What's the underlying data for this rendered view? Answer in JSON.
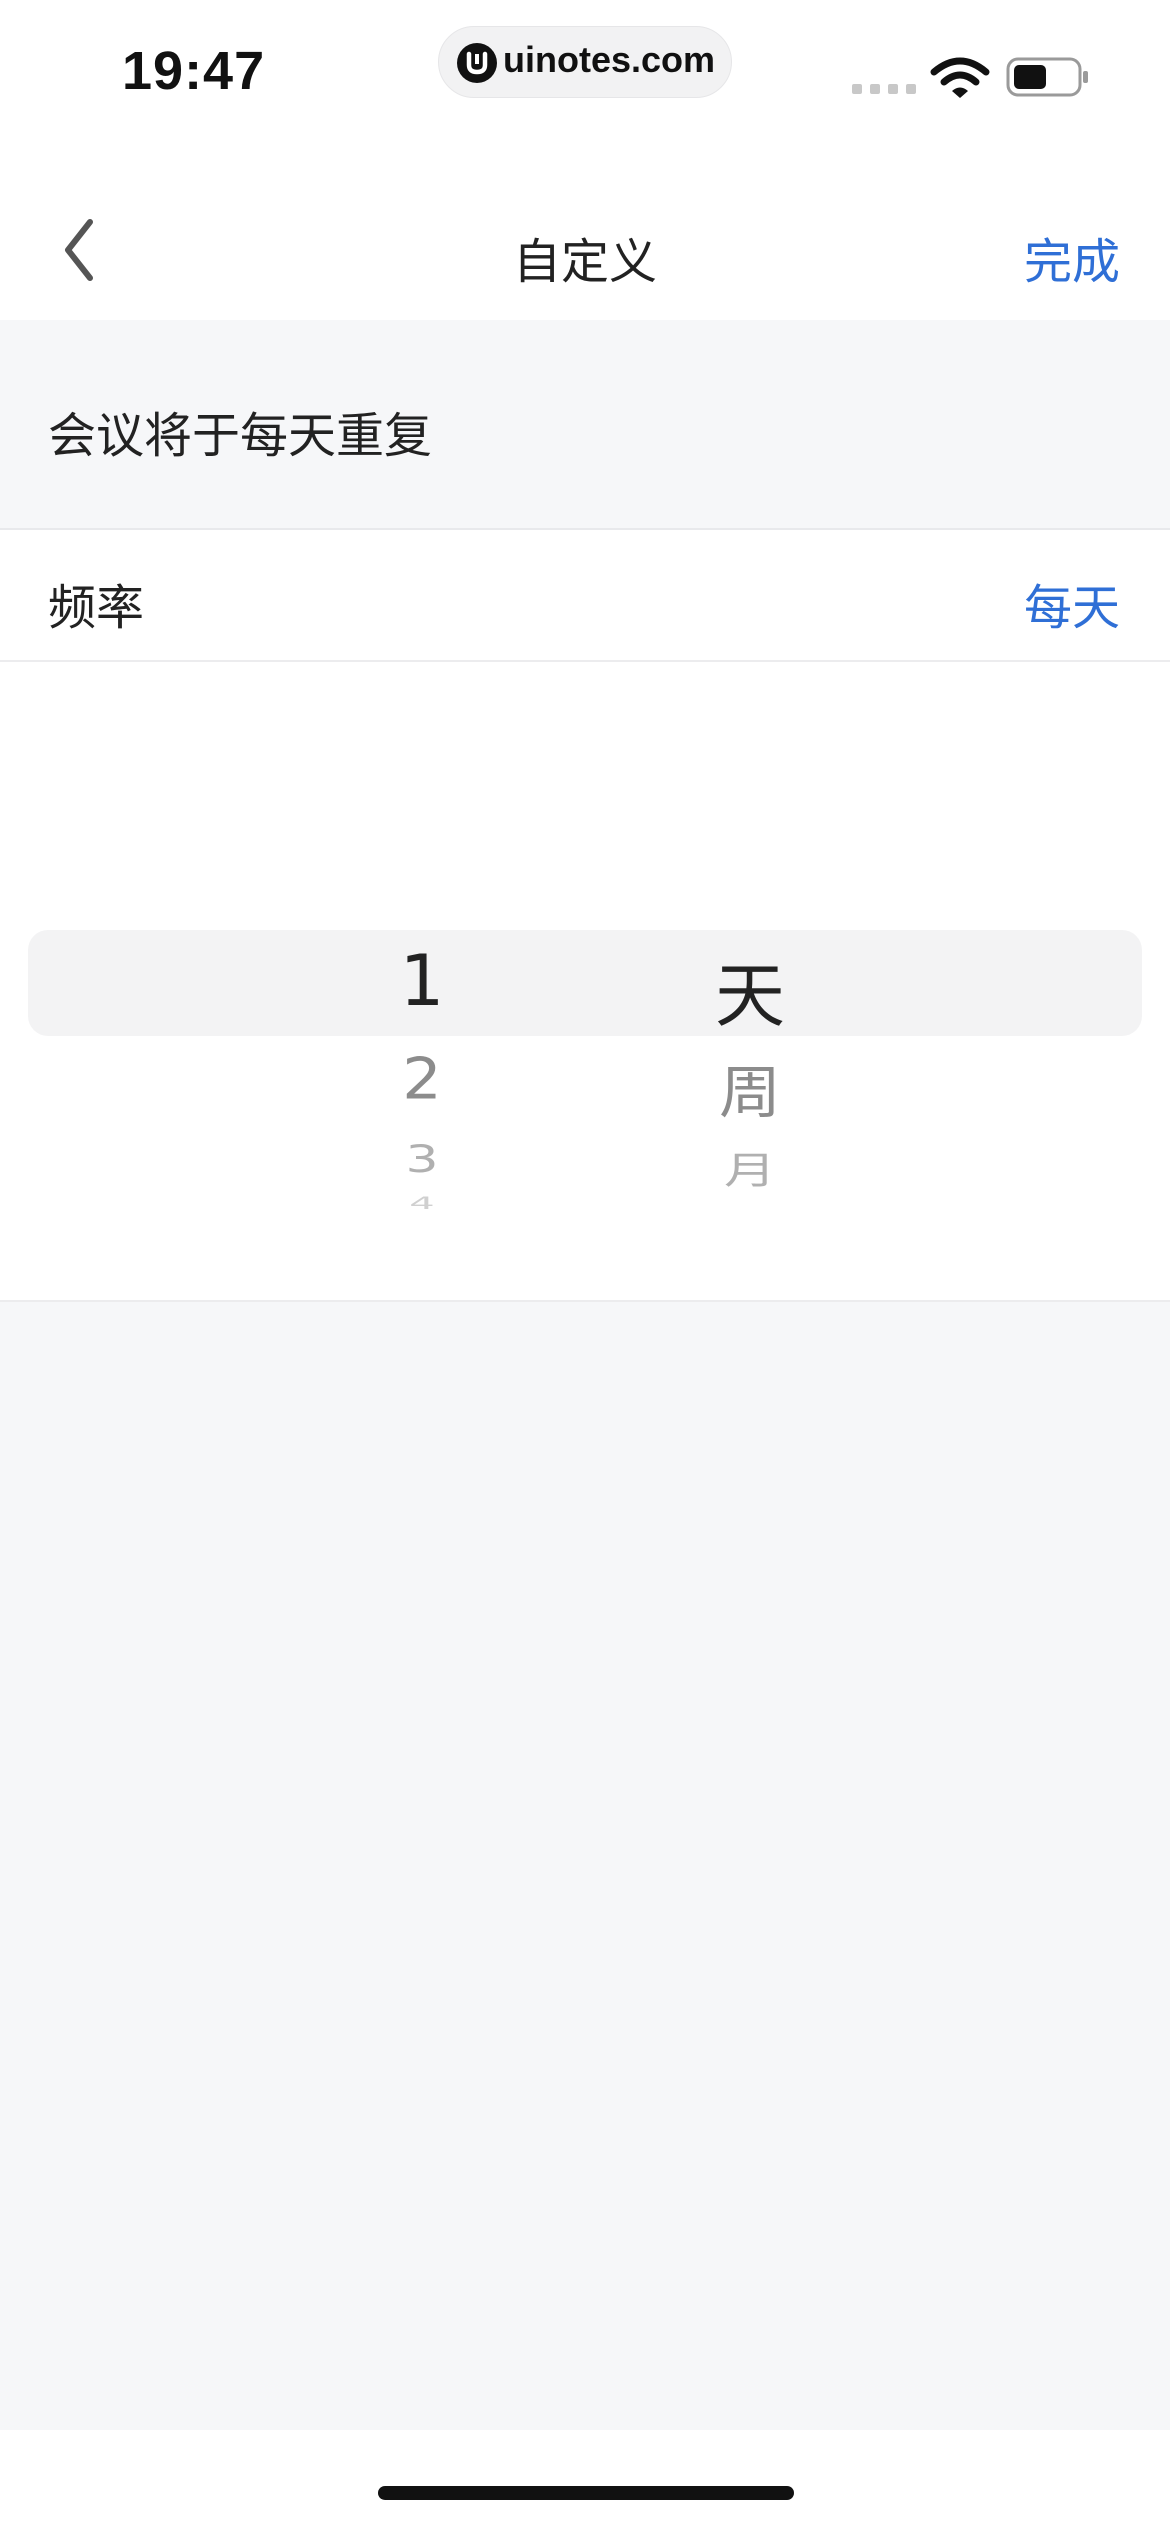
{
  "status_bar": {
    "time": "19:47",
    "url": "uinotes.com",
    "icons": [
      "signal-icon",
      "wifi-icon",
      "battery-icon"
    ]
  },
  "nav": {
    "back_icon": "chevron-left-icon",
    "title": "自定义",
    "done_label": "完成"
  },
  "summary": {
    "text": "会议将于每天重复"
  },
  "frequency": {
    "label": "频率",
    "value": "每天"
  },
  "picker": {
    "numbers": [
      "1",
      "2",
      "3",
      "4"
    ],
    "units": [
      "天",
      "周",
      "月"
    ],
    "selected_number": "1",
    "selected_unit": "天"
  },
  "colors": {
    "accent": "#2f6fd6",
    "background": "#f6f7f9",
    "text": "#222222"
  }
}
